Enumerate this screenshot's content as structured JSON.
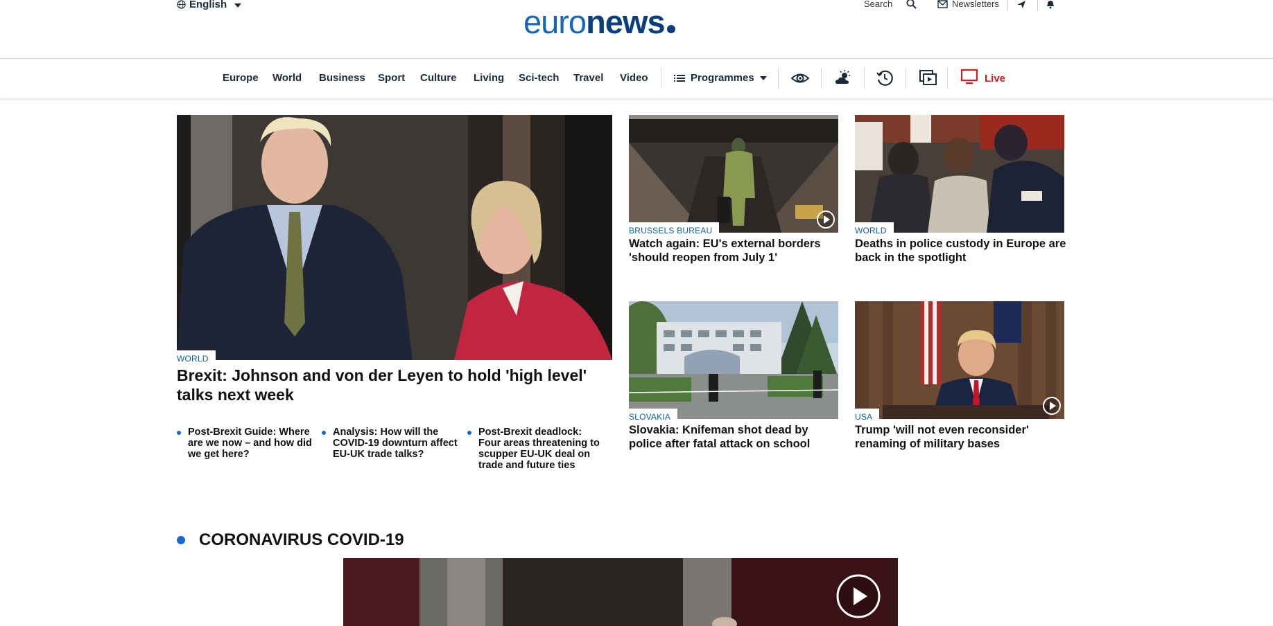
{
  "header": {
    "language": "English",
    "logo_light": "euro",
    "logo_bold": "news",
    "search_label": "Search",
    "newsletters_label": "Newsletters"
  },
  "nav": {
    "items": [
      "Europe",
      "World",
      "Business",
      "Sport",
      "Culture",
      "Living",
      "Sci-tech",
      "Travel",
      "Video"
    ],
    "programmes_label": "Programmes",
    "live_label": "Live",
    "icons": [
      "eye-icon",
      "weather-icon",
      "history-icon",
      "playlist-icon",
      "tv-icon"
    ]
  },
  "hero": {
    "tag": "WORLD",
    "headline": "Brexit: Johnson and von der Leyen to hold 'high level' talks next week",
    "related": [
      "Post-Brexit Guide: Where are we now – and how did we get here?",
      "Analysis: How will the COVID-19 downturn affect EU-UK trade talks?",
      "Post-Brexit deadlock: Four areas threatening to scupper EU-UK deal on trade and future ties"
    ]
  },
  "articles": [
    {
      "tag": "BRUSSELS BUREAU",
      "headline": "Watch again: EU's external borders 'should reopen from July 1'",
      "has_video": true
    },
    {
      "tag": "WORLD",
      "headline": "Deaths in police custody in Europe are back in the spotlight",
      "has_video": false
    },
    {
      "tag": "SLOVAKIA",
      "headline": "Slovakia: Knifeman shot dead by police after fatal attack on school",
      "has_video": false
    },
    {
      "tag": "USA",
      "headline": "Trump 'will not even reconsider' renaming of military bases",
      "has_video": true
    }
  ],
  "section": {
    "title": "CORONAVIRUS COVID-19"
  },
  "colors": {
    "brand_blue": "#0a3e7f",
    "accent_blue": "#1669d2",
    "tag_blue": "#0b5fa6",
    "live_red": "#e0161b"
  }
}
